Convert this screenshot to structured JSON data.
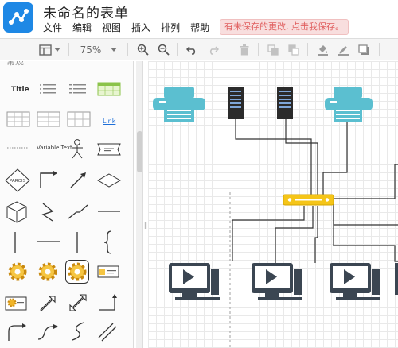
{
  "app": {
    "title": "未命名的表单",
    "logo_icon": "share-nodes-icon",
    "accent": "#1e88e5"
  },
  "menu": {
    "items": [
      "文件",
      "编辑",
      "视图",
      "插入",
      "排列",
      "帮助"
    ]
  },
  "notice": {
    "unsaved": "有未保存的更改, 点击我保存。"
  },
  "toolbar": {
    "zoom": "75%",
    "icons": [
      "layout-icon",
      "chevron-down-icon",
      "zoom-in-icon",
      "zoom-out-icon",
      "undo-icon",
      "redo-icon",
      "delete-icon",
      "to-front-icon",
      "to-back-icon",
      "fill-color-icon",
      "line-color-icon",
      "shadow-icon"
    ]
  },
  "sidebar": {
    "header_label": "常规",
    "shapes": {
      "title_label": "Title",
      "link_label": "Link",
      "variable_label": "Variable Text",
      "diamond_label": "PAROIS"
    }
  },
  "canvas": {
    "colors": {
      "printer": "#5bbfd0",
      "server": "#2b2b2b",
      "switch": "#f5c518",
      "monitor": "#3b4652",
      "connector": "#333333"
    },
    "icons": [
      "printer-icon",
      "server-icon",
      "server-icon",
      "printer-icon",
      "network-switch-icon",
      "video-monitor-icon",
      "video-monitor-icon",
      "video-monitor-icon"
    ]
  }
}
